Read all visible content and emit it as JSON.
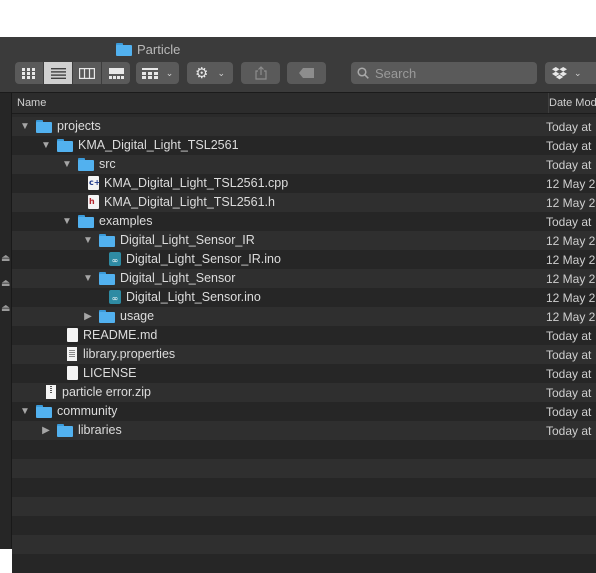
{
  "window": {
    "title": "Particle"
  },
  "toolbar": {
    "view_modes": [
      "icon-view",
      "list-view",
      "column-view",
      "gallery-view"
    ],
    "active_view": "list-view",
    "search_placeholder": "Search"
  },
  "columns": {
    "name": "Name",
    "date": "Date Modified"
  },
  "rows": [
    {
      "name": "projects",
      "date": "Today at",
      "kind": "folder",
      "level": 0,
      "disclosure": "expanded"
    },
    {
      "name": "KMA_Digital_Light_TSL2561",
      "date": "Today at",
      "kind": "folder",
      "level": 1,
      "disclosure": "expanded"
    },
    {
      "name": "src",
      "date": "Today at",
      "kind": "folder",
      "level": 2,
      "disclosure": "expanded"
    },
    {
      "name": "KMA_Digital_Light_TSL2561.cpp",
      "date": "12 May 2",
      "kind": "cpp",
      "level": 3,
      "disclosure": "none",
      "glyph": "c+"
    },
    {
      "name": "KMA_Digital_Light_TSL2561.h",
      "date": "12 May 2",
      "kind": "header",
      "level": 3,
      "disclosure": "none",
      "glyph": "h"
    },
    {
      "name": "examples",
      "date": "Today at",
      "kind": "folder",
      "level": 2,
      "disclosure": "expanded"
    },
    {
      "name": "Digital_Light_Sensor_IR",
      "date": "12 May 2",
      "kind": "folder",
      "level": 3,
      "disclosure": "expanded"
    },
    {
      "name": "Digital_Light_Sensor_IR.ino",
      "date": "12 May 2",
      "kind": "ino",
      "level": 4,
      "disclosure": "none",
      "glyph": "∞"
    },
    {
      "name": "Digital_Light_Sensor",
      "date": "12 May 2",
      "kind": "folder",
      "level": 3,
      "disclosure": "expanded"
    },
    {
      "name": "Digital_Light_Sensor.ino",
      "date": "12 May 2",
      "kind": "ino",
      "level": 4,
      "disclosure": "none",
      "glyph": "∞"
    },
    {
      "name": "usage",
      "date": "12 May 2",
      "kind": "folder",
      "level": 3,
      "disclosure": "collapsed"
    },
    {
      "name": "README.md",
      "date": "Today at",
      "kind": "doc",
      "level": 2,
      "disclosure": "none"
    },
    {
      "name": "library.properties",
      "date": "Today at",
      "kind": "text",
      "level": 2,
      "disclosure": "none"
    },
    {
      "name": "LICENSE",
      "date": "Today at",
      "kind": "doc",
      "level": 2,
      "disclosure": "none"
    },
    {
      "name": "particle error.zip",
      "date": "Today at",
      "kind": "zip",
      "level": 1,
      "disclosure": "none"
    },
    {
      "name": "community",
      "date": "Today at",
      "kind": "folder",
      "level": 0,
      "disclosure": "expanded"
    },
    {
      "name": "libraries",
      "date": "Today at",
      "kind": "folder",
      "level": 1,
      "disclosure": "collapsed"
    },
    {
      "name": "",
      "date": "",
      "kind": "empty",
      "level": 0,
      "disclosure": "none"
    },
    {
      "name": "",
      "date": "",
      "kind": "empty",
      "level": 0,
      "disclosure": "none"
    },
    {
      "name": "",
      "date": "",
      "kind": "empty",
      "level": 0,
      "disclosure": "none"
    },
    {
      "name": "",
      "date": "",
      "kind": "empty",
      "level": 0,
      "disclosure": "none"
    },
    {
      "name": "",
      "date": "",
      "kind": "empty",
      "level": 0,
      "disclosure": "none"
    },
    {
      "name": "",
      "date": "",
      "kind": "empty",
      "level": 0,
      "disclosure": "none"
    },
    {
      "name": "",
      "date": "",
      "kind": "empty",
      "level": 0,
      "disclosure": "none"
    }
  ],
  "colors": {
    "folder": "#52b1ef",
    "row_odd": "#2f2f2f",
    "row_even": "#262626",
    "ino": "#2e8ba3"
  }
}
